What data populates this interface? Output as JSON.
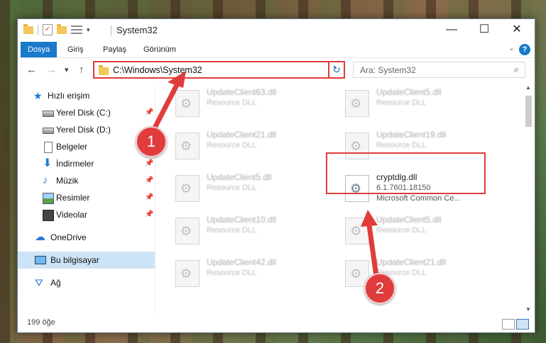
{
  "window": {
    "title": "System32",
    "controls": {
      "minimize": "—",
      "maximize": "☐",
      "close": "✕"
    }
  },
  "ribbon": {
    "tabs": [
      {
        "label": "Dosya",
        "active": true
      },
      {
        "label": "Giriş"
      },
      {
        "label": "Paylaş"
      },
      {
        "label": "Görünüm"
      }
    ],
    "help": "?"
  },
  "navigation": {
    "back": "←",
    "forward": "→",
    "recent": "▾",
    "up": "↑",
    "address": "C:\\Windows\\System32",
    "search_placeholder": "Ara: System32"
  },
  "sidebar": {
    "items": [
      {
        "label": "Hızlı erişim",
        "icon": "star-icon"
      },
      {
        "label": "Yerel Disk (C:)",
        "icon": "drive-icon",
        "pinned": true
      },
      {
        "label": "Yerel Disk (D:)",
        "icon": "drive-icon"
      },
      {
        "label": "Belgeler",
        "icon": "document-icon"
      },
      {
        "label": "İndirmeler",
        "icon": "download-icon",
        "pinned": true
      },
      {
        "label": "Müzik",
        "icon": "music-icon",
        "pinned": true
      },
      {
        "label": "Resimler",
        "icon": "picture-icon",
        "pinned": true
      },
      {
        "label": "Videolar",
        "icon": "video-icon",
        "pinned": true
      },
      {
        "label": "OneDrive",
        "icon": "cloud-icon"
      },
      {
        "label": "Bu bilgisayar",
        "icon": "computer-icon",
        "selected": true
      },
      {
        "label": "Ağ",
        "icon": "network-icon"
      }
    ]
  },
  "files": [
    {
      "name": "UpdateClient63.dll",
      "type": "Resource DLL"
    },
    {
      "name": "UpdateClient5.dll",
      "type": "Resource DLL"
    },
    {
      "name": "UpdateClient21.dll",
      "type": "Resource DLL"
    },
    {
      "name": "UpdateClient19.dll",
      "type": "Resource DLL"
    },
    {
      "name": "UpdateClient5.dll",
      "type": "Resource DLL"
    },
    {
      "name": "cryptdlg.dll",
      "type": "6.1.7601.18150",
      "meta": "Microsoft Common Ce...",
      "highlighted": true
    },
    {
      "name": "UpdateClient10.dll",
      "type": "Resource DLL"
    },
    {
      "name": "UpdateClient5.dll",
      "type": "Resource DLL"
    },
    {
      "name": "UpdateClient42.dll",
      "type": "Resource DLL"
    },
    {
      "name": "UpdateClient21.dll",
      "type": "Resource DLL"
    }
  ],
  "status": {
    "count": "199 öğe"
  },
  "annotations": {
    "step1": "1",
    "step2": "2",
    "color": "#e03c3c"
  },
  "colors": {
    "accent": "#1979ca",
    "highlight": "#e03c3c",
    "selected": "#cce4f7"
  }
}
